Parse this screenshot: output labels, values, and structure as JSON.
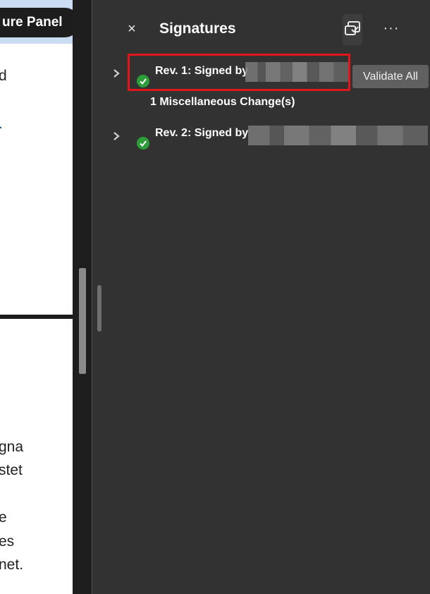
{
  "document": {
    "tab_label": "ure Panel",
    "text_fragments": [
      "d",
      ".",
      "gna",
      "stet",
      "e",
      "es",
      "net."
    ]
  },
  "panel": {
    "title": "Signatures",
    "close_icon": "close-icon",
    "validate_icon": "validate-all-icon",
    "more_icon": "more-options-icon",
    "more_label": "···",
    "close_label": "×"
  },
  "revisions": [
    {
      "label": "Rev. 1: Signed by",
      "status": "valid",
      "details": "1 Miscellaneous Change(s)"
    },
    {
      "label": "Rev. 2: Signed by",
      "status": "valid"
    }
  ],
  "tooltip": {
    "text": "Validate All"
  },
  "colors": {
    "panel_bg": "#323232",
    "valid_green": "#2d9d3a",
    "highlight_red": "#e0161b",
    "tab_blue": "#c9dcf2"
  }
}
